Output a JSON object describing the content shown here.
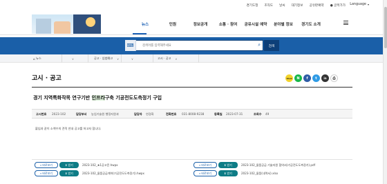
{
  "utility": {
    "links": [
      "경기도청",
      "조직도",
      "날씨",
      "대기정보",
      "공유판예약"
    ],
    "allsites": "글목가가",
    "language": "Language"
  },
  "gnb": {
    "items": [
      "뉴스",
      "민원",
      "정보공개",
      "소통 · 참여",
      "공유시설 예약",
      "분야별 정보",
      "경기도 소개"
    ],
    "active": "뉴스"
  },
  "search": {
    "placeholder": "검색어를 입력해주세요",
    "button": "검색"
  },
  "breadcrumb": {
    "home": "뉴스",
    "items": [
      "공고 · 입법예고",
      "고시 · 공고"
    ]
  },
  "page": {
    "title": "고시 · 공고"
  },
  "share": {
    "talk": "TALK",
    "n": "N",
    "f": "f",
    "t": "t",
    "i": "in",
    "p": "⎙"
  },
  "article": {
    "title_before": "경기 지역특화작목 연구기반 ",
    "title_highlight": "인프라",
    "title_after": "구축 기공전도도측정기 구입",
    "meta": {
      "k_no": "고시번호",
      "v_no": "2023-102",
      "k_dept": "담당부서",
      "v_dept": "농업기술원 행정지원과",
      "k_person": "담당자",
      "v_person": "연경화",
      "k_tel": "전화번호",
      "v_tel": "031-8008-9238",
      "k_date": "등록일",
      "v_date": "2023-07-31",
      "k_views": "조회수",
      "v_views": "49"
    },
    "body": "붙임과 같이 소액수의 견적 안내 공고를 하고자 합니다."
  },
  "attachments": {
    "view_label": "바로보기",
    "download_label": "받기",
    "files": [
      "2023-102_★1공고문.hwpx",
      "2023-102_물품공급 기술지원 협약서(기공전도도측정기).pdf",
      "2023-102_물품공급계약(기공전도도측정기).hwpx",
      "2023-102_물품(내역서).xlsx"
    ]
  }
}
